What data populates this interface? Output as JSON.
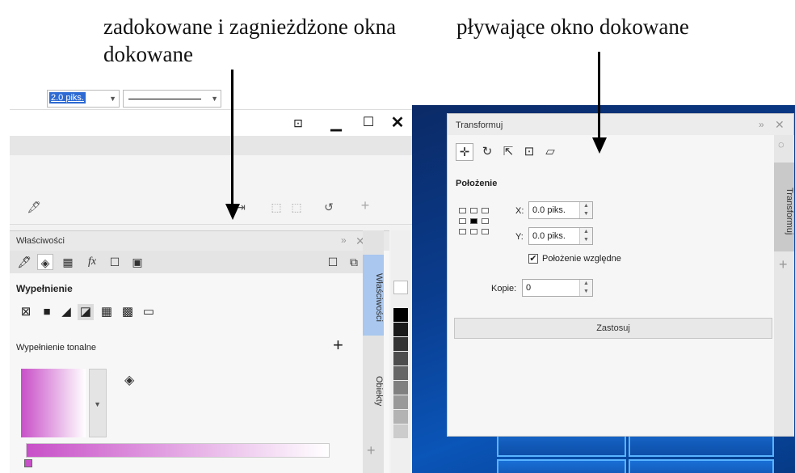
{
  "captions": {
    "left": "zadokowane i zagnieżdżone okna dokowane",
    "right": "pływające okno dokowane"
  },
  "properties_bar": {
    "pen_size": "2.0 piks."
  },
  "properties_docker": {
    "title": "Właściwości",
    "fill_section": "Wypełnienie",
    "fill_type_label": "Wypełnienie tonalne"
  },
  "side_tabs": {
    "properties": "Właściwości",
    "objects": "Obiekty"
  },
  "transform_docker": {
    "title": "Transformuj",
    "section_title": "Położenie",
    "x_label": "X:",
    "x_value": "0.0 piks.",
    "y_label": "Y:",
    "y_value": "0.0 piks.",
    "relative_label": "Położenie względne",
    "relative_checked": true,
    "copies_label": "Kopie:",
    "copies_value": "0",
    "apply_label": "Zastosuj",
    "side_tab": "Transformuj"
  },
  "palette_colors": [
    "#ffffff",
    "#000000",
    "#1a1a1a",
    "#333333",
    "#4d4d4d",
    "#666666",
    "#808080",
    "#999999",
    "#b3b3b3",
    "#cccccc"
  ],
  "icons": [
    "user-icon",
    "minimize-icon",
    "maximize-icon",
    "close-icon",
    "pen-icon",
    "fill-icon",
    "plus-icon",
    "rotate-icon",
    "scale-icon",
    "size-icon",
    "skew-icon",
    "position-icon"
  ]
}
